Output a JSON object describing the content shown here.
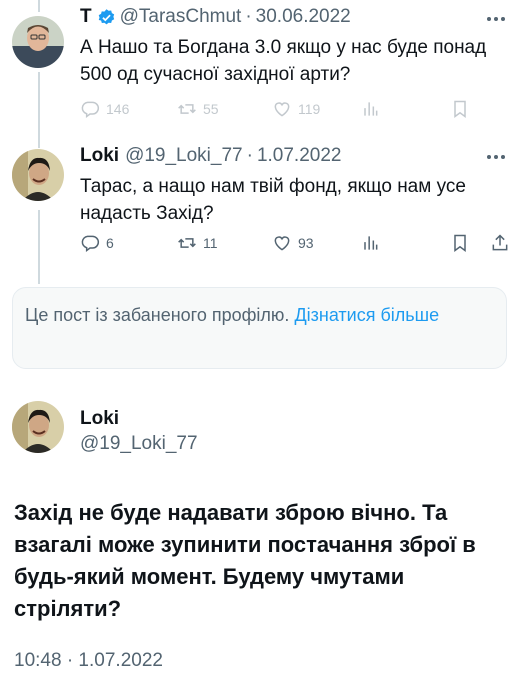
{
  "tweets": [
    {
      "name": "T",
      "verified": true,
      "handle": "@TarasChmut",
      "separator": "·",
      "date": "30.06.2022",
      "text": "А Нашо та Богдана 3.0 якщо у нас буде понад 500 од сучасної західної арти?",
      "replies": "146",
      "retweets": "55",
      "likes": "119"
    },
    {
      "name": "Loki",
      "handle": "@19_Loki_77",
      "separator": "·",
      "date": "1.07.2022",
      "text": "Тарас, а нащо нам твій фонд, якщо нам усе надасть Захід?",
      "replies": "6",
      "retweets": "11",
      "likes": "93"
    }
  ],
  "banner": {
    "text": "Це пост із забаненого профілю.",
    "link": "Дізнатися більше"
  },
  "main_tweet": {
    "name": "Loki",
    "handle": "@19_Loki_77",
    "text": "Захід не буде надавати зброю вічно. Та взагалі може зупинити постачання зброї в будь-який момент. Будему чмутами стріляти?",
    "time": "10:48 · 1.07.2022"
  },
  "icons": {
    "reply": "reply-icon",
    "retweet": "retweet-icon",
    "like": "heart-icon",
    "views": "views-icon",
    "bookmark": "bookmark-icon",
    "share": "share-icon",
    "more": "more-icon",
    "verified": "verified-badge-icon"
  },
  "colors": {
    "accent": "#1d9bf0",
    "muted": "#536471",
    "text": "#0f1419"
  }
}
